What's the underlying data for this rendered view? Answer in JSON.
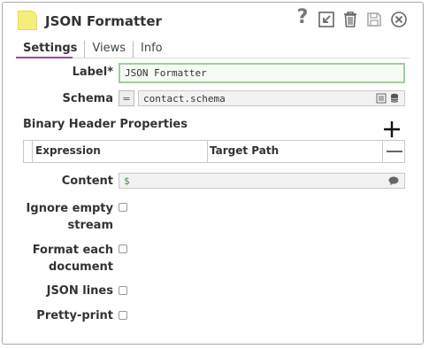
{
  "header": {
    "title": "JSON Formatter",
    "help_label": "?"
  },
  "tabs": [
    {
      "label": "Settings"
    },
    {
      "label": "Views"
    },
    {
      "label": "Info"
    }
  ],
  "form": {
    "label_label": "Label*",
    "label_value": "JSON Formatter",
    "schema_label": "Schema",
    "schema_expr": "=",
    "schema_value": "contact.schema",
    "binary_header_title": "Binary Header Properties",
    "col_expression": "Expression",
    "col_target_path": "Target Path",
    "content_label": "Content",
    "content_value": "$",
    "ignore_empty_line1": "Ignore empty",
    "ignore_empty_line2": "stream",
    "format_each_line1": "Format each",
    "format_each_line2": "document",
    "json_lines_label": "JSON lines",
    "pretty_print_label": "Pretty-print"
  },
  "colors": {
    "accent": "#8a4e9c",
    "valid_border": "#9bcf9b",
    "icon_yellow": "#f6ee7a"
  }
}
